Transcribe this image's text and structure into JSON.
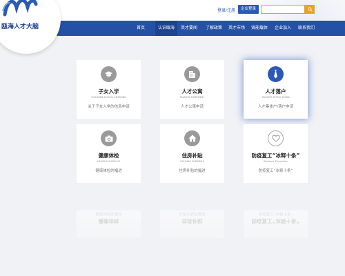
{
  "brand": {
    "name": "瓯海人才大脑"
  },
  "header": {
    "login_link": "登录/注册",
    "corp_login": "企业登录",
    "search_placeholder": ""
  },
  "nav": {
    "items": [
      {
        "label": "首页"
      },
      {
        "label": "认识瓯海"
      },
      {
        "label": "英才要闻"
      },
      {
        "label": "了解政策"
      },
      {
        "label": "英才市场"
      },
      {
        "label": "贤能载体"
      },
      {
        "label": "企业加入"
      },
      {
        "label": "联系我们"
      }
    ],
    "active_index": 1
  },
  "cards": [
    {
      "title": "子女入学",
      "subtitle": "CHILDREN SCHOOL ENTERING",
      "desc": "关于子女入学的信息申请",
      "icon": "graduation-cap-icon"
    },
    {
      "title": "人才公寓",
      "subtitle": "TALENTS APARTMENT",
      "desc": "人才公寓申请",
      "icon": "building-icon"
    },
    {
      "title": "人才落户",
      "subtitle": "TALENTS SETTLE DOWN",
      "desc": "人才集体户/落户申请",
      "icon": "tie-icon"
    },
    {
      "title": "健康体检",
      "subtitle": "HEALTHY CHECK-UP",
      "desc": "健康体检的福进",
      "icon": "camera-icon"
    },
    {
      "title": "住房补贴",
      "subtitle": "HOUSING SUBSIDIES",
      "desc": "住房补贴的福进",
      "icon": "house-icon"
    },
    {
      "title": "防疫复工“冰释十条”",
      "subtitle": "Epidemic Prevention",
      "desc": "防疫复工“冰释十条”",
      "icon": "heart-icon"
    }
  ],
  "colors": {
    "primary": "#2451a6",
    "accent": "#f0a020",
    "highlight_icon": "#2b59b6",
    "icon_gray": "#9a9a9a",
    "background": "#f1f2f6"
  }
}
